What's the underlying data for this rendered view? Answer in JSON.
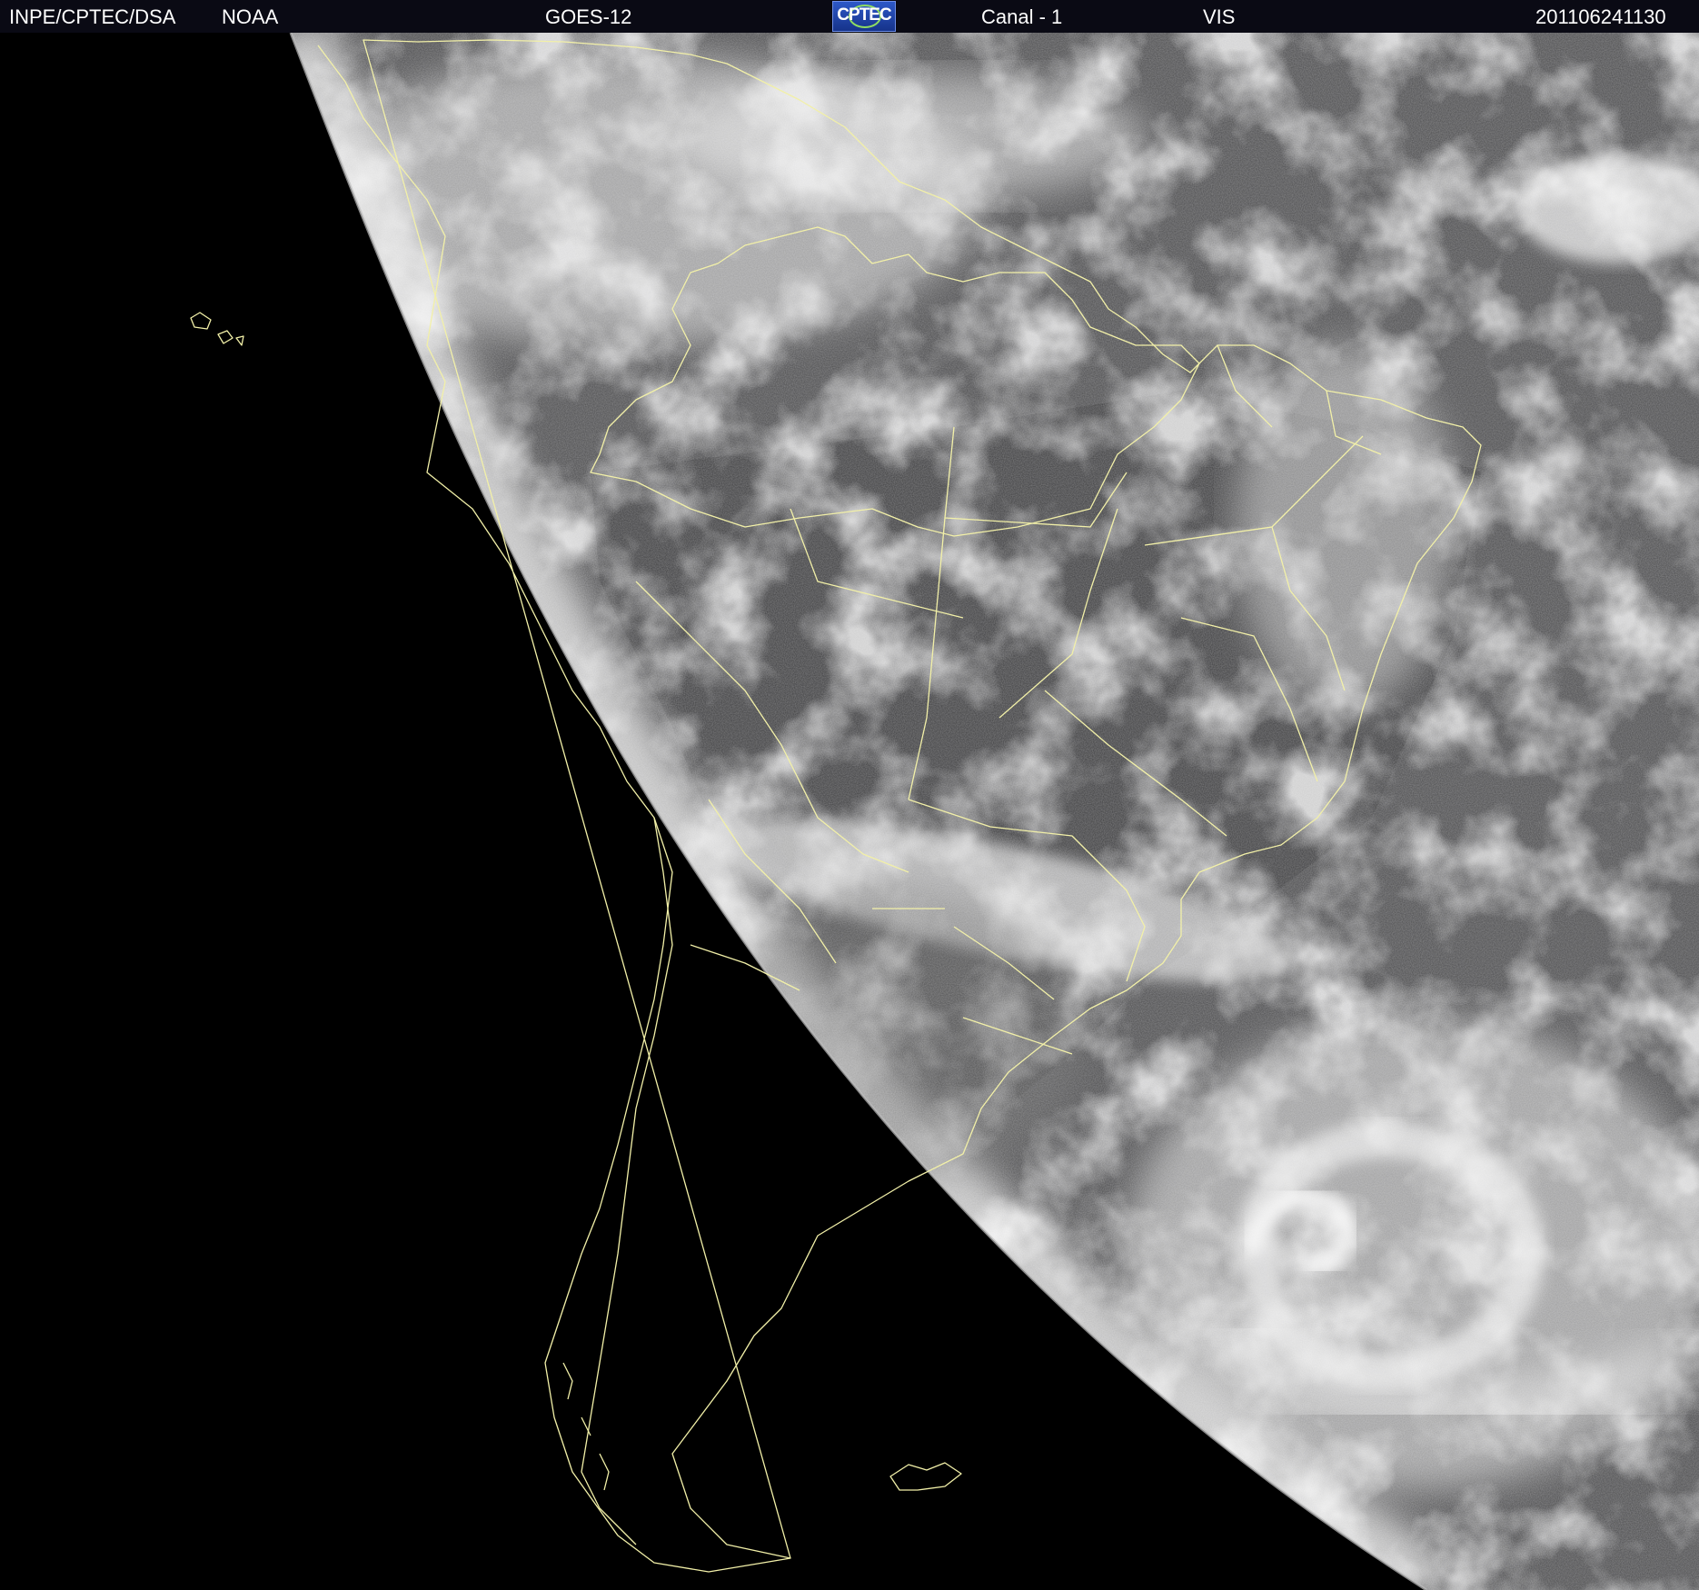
{
  "header": {
    "source": "INPE/CPTEC/DSA",
    "agency": "NOAA",
    "satellite": "GOES-12",
    "logo_text": "CPTEC",
    "channel": "Canal - 1",
    "band": "VIS",
    "timestamp": "201106241130"
  },
  "image": {
    "type": "visible-band satellite image of South America",
    "overlay_color": "#f2f0a8",
    "space_color": "#000000",
    "ocean_color": "#4a4a4a",
    "cloud_color": "#e8e8e8"
  }
}
